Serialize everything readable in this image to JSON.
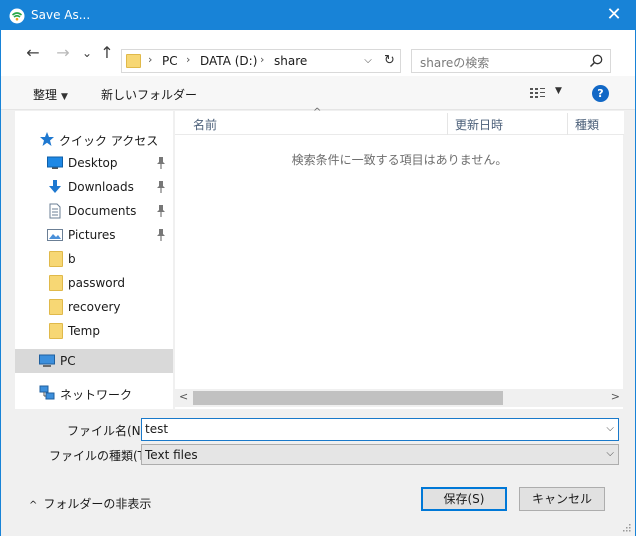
{
  "window": {
    "title": "Save As...",
    "close_glyph": "✕",
    "title_icon": "wifi-app-icon",
    "accent_color": "#1883d7"
  },
  "navigation": {
    "back_glyph": "←",
    "forward_glyph": "→",
    "history_glyph": "⌄",
    "up_glyph": "↑"
  },
  "address": {
    "crumbs": [
      "PC",
      "DATA (D:)",
      "share"
    ],
    "separator": "›",
    "dropdown_glyph": "⌵",
    "refresh_glyph": "↻"
  },
  "search": {
    "placeholder": "shareの検索",
    "icon": "search-icon"
  },
  "toolbar": {
    "organize_label": "整理",
    "organize_caret": "▼",
    "new_folder_label": "新しいフォルダー",
    "view_caret": "▼",
    "help_label": "?"
  },
  "sidebar": {
    "quick_access_label": "クイック アクセス",
    "pin_glyph": "📌",
    "items": [
      {
        "label": "Desktop",
        "icon": "desktop-icon",
        "pinned": true
      },
      {
        "label": "Downloads",
        "icon": "download-arrow-icon",
        "pinned": true
      },
      {
        "label": "Documents",
        "icon": "document-icon",
        "pinned": true
      },
      {
        "label": "Pictures",
        "icon": "pictures-icon",
        "pinned": true
      },
      {
        "label": "b",
        "icon": "folder-icon",
        "pinned": false
      },
      {
        "label": "password",
        "icon": "folder-icon",
        "pinned": false
      },
      {
        "label": "recovery",
        "icon": "folder-icon",
        "pinned": false
      },
      {
        "label": "Temp",
        "icon": "folder-icon",
        "pinned": false
      }
    ],
    "pc_label": "PC",
    "network_label": "ネットワーク"
  },
  "content": {
    "columns": [
      "名前",
      "更新日時",
      "種類"
    ],
    "sort_caret": "^",
    "empty_message": "検索条件に一致する項目はありません。",
    "scroll_left": "<",
    "scroll_right": ">"
  },
  "form": {
    "filename_label": "ファイル名(N):",
    "filename_value": "test",
    "filetype_label": "ファイルの種類(T):",
    "filetype_value": "Text files",
    "dropdown_glyph": "⌵",
    "hide_folders_label": "フォルダーの非表示",
    "hide_caret": "^",
    "save_label": "保存(S)",
    "cancel_label": "キャンセル"
  }
}
